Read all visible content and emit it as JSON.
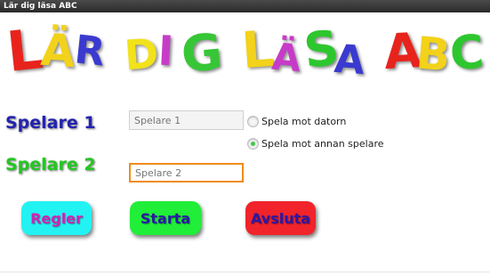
{
  "window": {
    "title": "Lär dig läsa ABC"
  },
  "header": {
    "letters": [
      {
        "char": "L",
        "color": "#e8231c"
      },
      {
        "char": "Ä",
        "color": "#f2d21a"
      },
      {
        "char": "R",
        "color": "#3a3ad0"
      },
      {
        "char": "D",
        "color": "#f2e21a"
      },
      {
        "char": "I",
        "color": "#c63cc8"
      },
      {
        "char": "G",
        "color": "#36c636"
      },
      {
        "char": "L",
        "color": "#f2d21a"
      },
      {
        "char": "Ä",
        "color": "#c63cc8"
      },
      {
        "char": "S",
        "color": "#2ec62e"
      },
      {
        "char": "A",
        "color": "#3a3ad0"
      },
      {
        "char": "A",
        "color": "#e8231c"
      },
      {
        "char": "B",
        "color": "#f2d21a"
      },
      {
        "char": "C",
        "color": "#2ec62e"
      }
    ]
  },
  "players": {
    "player1_label": "Spelare 1",
    "player1_label_color": "#2323b0",
    "player1_placeholder": "Spelare 1",
    "player2_label": "Spelare 2",
    "player2_label_color": "#22c722",
    "player2_placeholder": "Spelare 2"
  },
  "mode": {
    "option_computer": "Spela mot datorn",
    "option_player": "Spela mot annan spelare",
    "selected": "Spela mot annan spelare"
  },
  "buttons": {
    "rules_label": "Regler",
    "rules_bg": "#22f2f2",
    "rules_text": "#d420b4",
    "start_label": "Starta",
    "start_bg": "#20ee38",
    "start_text": "#2a18a8",
    "quit_label": "Avsluta",
    "quit_bg": "#f0242a",
    "quit_text": "#2a18a8"
  }
}
